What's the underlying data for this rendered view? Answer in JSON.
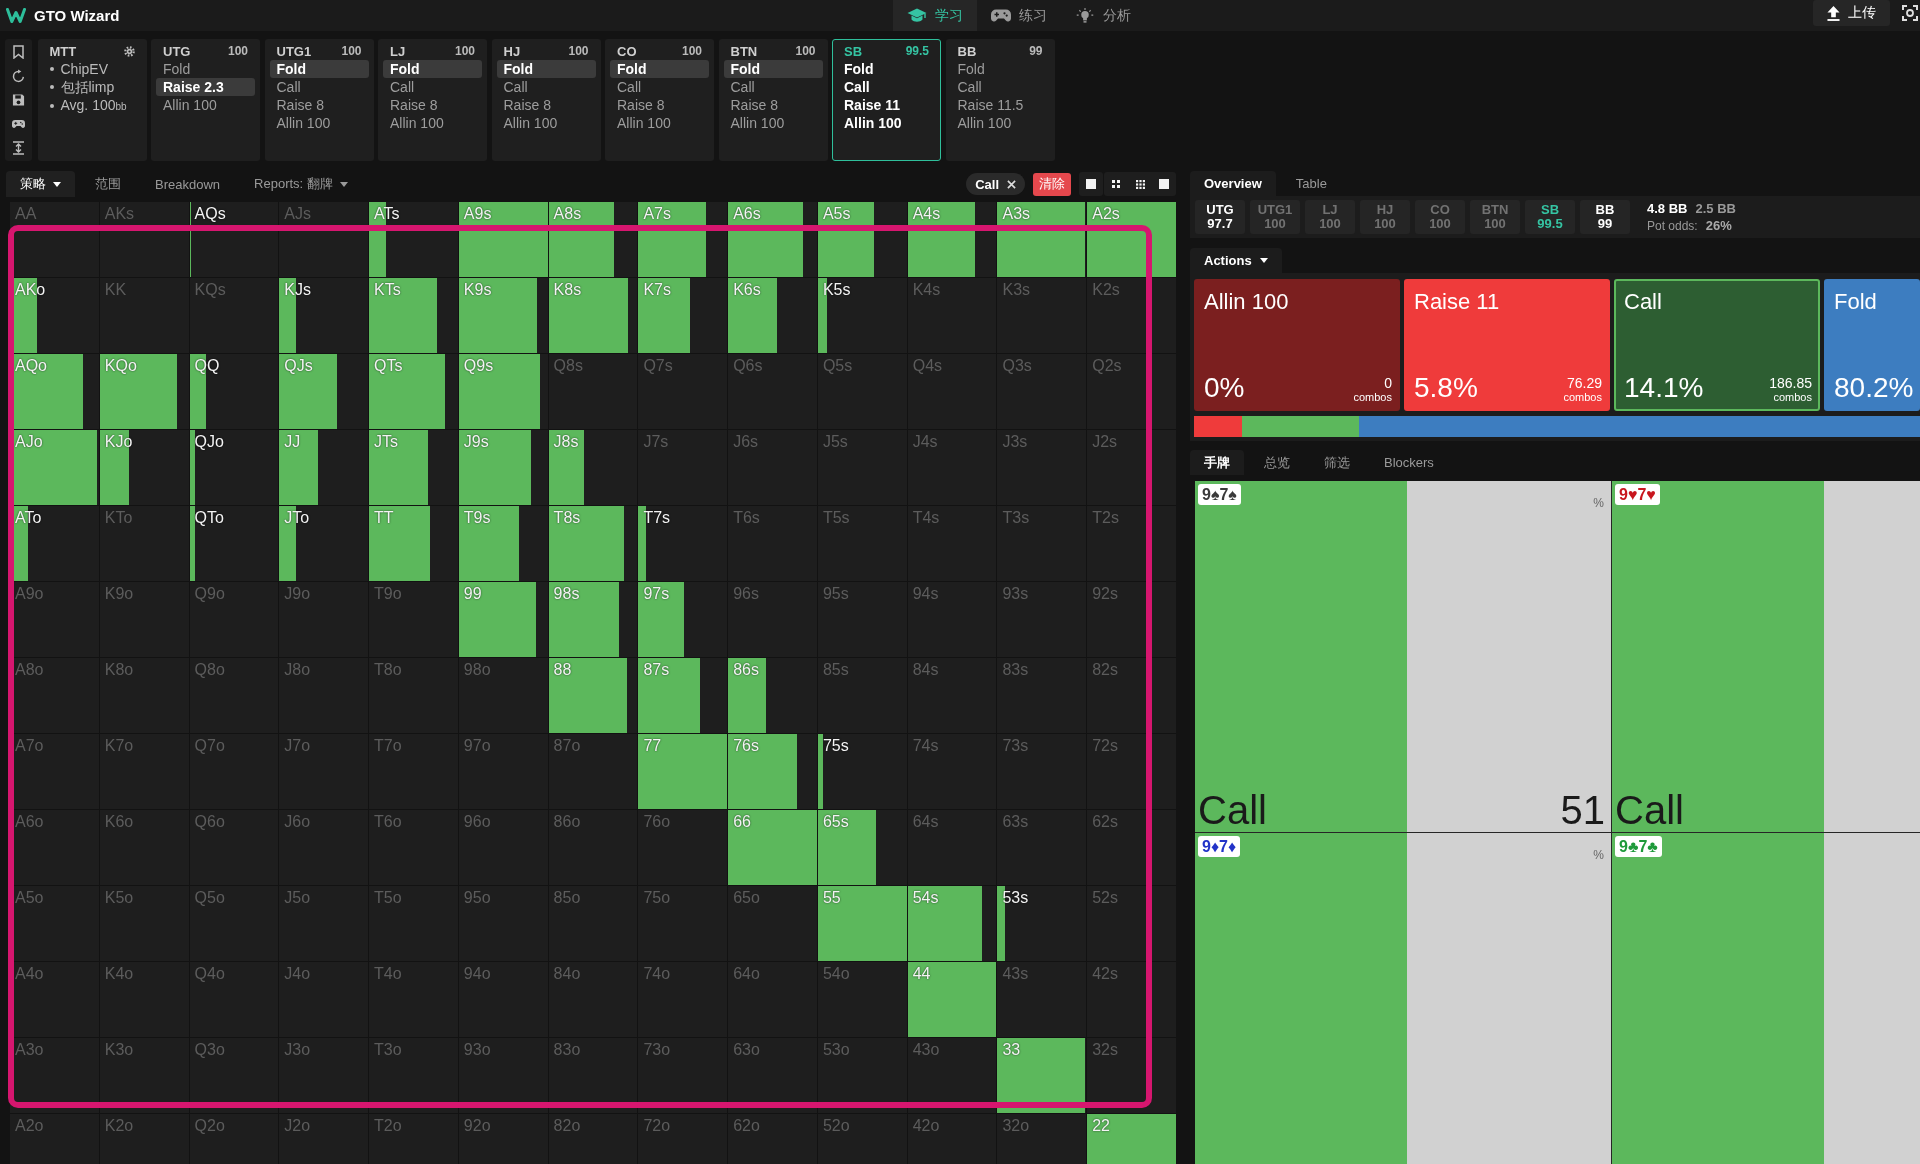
{
  "app_bar": {
    "title": "GTO Wizard",
    "nav": [
      {
        "label": "学习",
        "selected": true
      },
      {
        "label": "练习",
        "selected": false
      },
      {
        "label": "分析",
        "selected": false
      }
    ],
    "upload_button": "上传"
  },
  "settings_card": {
    "title": "MTT",
    "items": [
      "ChipEV",
      "包括limp",
      "Avg. 100$_{bb}$"
    ]
  },
  "positions": [
    {
      "name": "UTG",
      "stack": "100",
      "selected": false,
      "options": [
        {
          "label": "Fold",
          "selected": false
        },
        {
          "label": "Raise 2.3",
          "selected": true
        },
        {
          "label": "Allin 100",
          "selected": false
        }
      ]
    },
    {
      "name": "UTG1",
      "stack": "100",
      "selected": false,
      "options": [
        {
          "label": "Fold",
          "selected": true
        },
        {
          "label": "Call",
          "selected": false
        },
        {
          "label": "Raise 8",
          "selected": false
        },
        {
          "label": "Allin 100",
          "selected": false
        }
      ]
    },
    {
      "name": "LJ",
      "stack": "100",
      "selected": false,
      "options": [
        {
          "label": "Fold",
          "selected": true
        },
        {
          "label": "Call",
          "selected": false
        },
        {
          "label": "Raise 8",
          "selected": false
        },
        {
          "label": "Allin 100",
          "selected": false
        }
      ]
    },
    {
      "name": "HJ",
      "stack": "100",
      "selected": false,
      "options": [
        {
          "label": "Fold",
          "selected": true
        },
        {
          "label": "Call",
          "selected": false
        },
        {
          "label": "Raise 8",
          "selected": false
        },
        {
          "label": "Allin 100",
          "selected": false
        }
      ]
    },
    {
      "name": "CO",
      "stack": "100",
      "selected": false,
      "options": [
        {
          "label": "Fold",
          "selected": true
        },
        {
          "label": "Call",
          "selected": false
        },
        {
          "label": "Raise 8",
          "selected": false
        },
        {
          "label": "Allin 100",
          "selected": false
        }
      ]
    },
    {
      "name": "BTN",
      "stack": "100",
      "selected": false,
      "options": [
        {
          "label": "Fold",
          "selected": true
        },
        {
          "label": "Call",
          "selected": false
        },
        {
          "label": "Raise 8",
          "selected": false
        },
        {
          "label": "Allin 100",
          "selected": false
        }
      ]
    },
    {
      "name": "SB",
      "stack": "99.5",
      "selected": true,
      "options": [
        {
          "label": "Fold",
          "selected": false
        },
        {
          "label": "Call",
          "selected": false
        },
        {
          "label": "Raise 11",
          "selected": false
        },
        {
          "label": "Allin 100",
          "selected": false
        }
      ]
    },
    {
      "name": "BB",
      "stack": "99",
      "selected": false,
      "options": [
        {
          "label": "Fold",
          "selected": false
        },
        {
          "label": "Call",
          "selected": false
        },
        {
          "label": "Raise 11.5",
          "selected": false
        },
        {
          "label": "Allin 100",
          "selected": false
        }
      ]
    }
  ],
  "view_tabs": [
    {
      "label": "策略",
      "selected": true,
      "has_menu": true
    },
    {
      "label": "范围",
      "selected": false,
      "has_menu": false
    },
    {
      "label": "Breakdown",
      "selected": false,
      "has_menu": false
    },
    {
      "label": "Reports: 翻牌",
      "selected": false,
      "has_menu": true
    }
  ],
  "filter_chip": "Call",
  "clear_button": "清除",
  "range_grid": {
    "rows": [
      [
        {
          "label": "AA"
        },
        {
          "label": "AKs"
        },
        {
          "label": "AQs",
          "level": 0.02
        },
        {
          "label": "AJs"
        },
        {
          "label": "ATs",
          "level": 0.19
        },
        {
          "label": "A9s",
          "level": 1
        },
        {
          "label": "A8s",
          "level": 0.74
        },
        {
          "label": "A7s",
          "level": 0.76
        },
        {
          "label": "A6s",
          "level": 0.84
        },
        {
          "label": "A5s",
          "level": 0.63
        },
        {
          "label": "A4s",
          "level": 0.76
        },
        {
          "label": "A3s",
          "level": 0.99
        },
        {
          "label": "A2s",
          "level": 1
        }
      ],
      [
        {
          "label": "AKo",
          "level": 0.3
        },
        {
          "label": "KK"
        },
        {
          "label": "KQs"
        },
        {
          "label": "KJs",
          "level": 0.19
        },
        {
          "label": "KTs",
          "level": 0.76
        },
        {
          "label": "K9s",
          "level": 0.88
        },
        {
          "label": "K8s",
          "level": 0.89
        },
        {
          "label": "K7s",
          "level": 0.58
        },
        {
          "label": "K6s",
          "level": 0.55
        },
        {
          "label": "K5s",
          "level": 0.1
        },
        {
          "label": "K4s"
        },
        {
          "label": "K3s"
        },
        {
          "label": "K2s"
        }
      ],
      [
        {
          "label": "AQo",
          "level": 0.82
        },
        {
          "label": "KQo",
          "level": 0.87
        },
        {
          "label": "QQ",
          "level": 0.18
        },
        {
          "label": "QJs",
          "level": 0.65
        },
        {
          "label": "QTs",
          "level": 0.85
        },
        {
          "label": "Q9s",
          "level": 0.91
        },
        {
          "label": "Q8s"
        },
        {
          "label": "Q7s"
        },
        {
          "label": "Q6s"
        },
        {
          "label": "Q5s"
        },
        {
          "label": "Q4s"
        },
        {
          "label": "Q3s"
        },
        {
          "label": "Q2s"
        }
      ],
      [
        {
          "label": "AJo",
          "level": 0.98
        },
        {
          "label": "KJo",
          "level": 0.33
        },
        {
          "label": "QJo",
          "level": 0.06
        },
        {
          "label": "JJ",
          "level": 0.44
        },
        {
          "label": "JTs",
          "level": 0.66
        },
        {
          "label": "J9s",
          "level": 0.81
        },
        {
          "label": "J8s",
          "level": 0.4
        },
        {
          "label": "J7s"
        },
        {
          "label": "J6s"
        },
        {
          "label": "J5s"
        },
        {
          "label": "J4s"
        },
        {
          "label": "J3s"
        },
        {
          "label": "J2s"
        }
      ],
      [
        {
          "label": "ATo",
          "level": 0.2
        },
        {
          "label": "KTo"
        },
        {
          "label": "QTo",
          "level": 0.06
        },
        {
          "label": "JTo",
          "level": 0.19
        },
        {
          "label": "TT",
          "level": 0.69
        },
        {
          "label": "T9s",
          "level": 0.68
        },
        {
          "label": "T8s",
          "level": 0.85
        },
        {
          "label": "T7s",
          "level": 0.09
        },
        {
          "label": "T6s"
        },
        {
          "label": "T5s"
        },
        {
          "label": "T4s"
        },
        {
          "label": "T3s"
        },
        {
          "label": "T2s"
        }
      ],
      [
        {
          "label": "A9o"
        },
        {
          "label": "K9o"
        },
        {
          "label": "Q9o"
        },
        {
          "label": "J9o"
        },
        {
          "label": "T9o"
        },
        {
          "label": "99",
          "level": 0.87
        },
        {
          "label": "98s",
          "level": 0.79
        },
        {
          "label": "97s",
          "level": 0.51
        },
        {
          "label": "96s"
        },
        {
          "label": "95s"
        },
        {
          "label": "94s"
        },
        {
          "label": "93s"
        },
        {
          "label": "92s"
        }
      ],
      [
        {
          "label": "A8o"
        },
        {
          "label": "K8o"
        },
        {
          "label": "Q8o"
        },
        {
          "label": "J8o"
        },
        {
          "label": "T8o"
        },
        {
          "label": "98o"
        },
        {
          "label": "88",
          "level": 0.88
        },
        {
          "label": "87s",
          "level": 0.69
        },
        {
          "label": "86s",
          "level": 0.43
        },
        {
          "label": "85s"
        },
        {
          "label": "84s"
        },
        {
          "label": "83s"
        },
        {
          "label": "82s"
        }
      ],
      [
        {
          "label": "A7o"
        },
        {
          "label": "K7o"
        },
        {
          "label": "Q7o"
        },
        {
          "label": "J7o"
        },
        {
          "label": "T7o"
        },
        {
          "label": "97o"
        },
        {
          "label": "87o"
        },
        {
          "label": "77",
          "level": 1
        },
        {
          "label": "76s",
          "level": 0.78
        },
        {
          "label": "75s",
          "level": 0.06
        },
        {
          "label": "74s"
        },
        {
          "label": "73s"
        },
        {
          "label": "72s"
        }
      ],
      [
        {
          "label": "A6o"
        },
        {
          "label": "K6o"
        },
        {
          "label": "Q6o"
        },
        {
          "label": "J6o"
        },
        {
          "label": "T6o"
        },
        {
          "label": "96o"
        },
        {
          "label": "86o"
        },
        {
          "label": "76o"
        },
        {
          "label": "66",
          "level": 1
        },
        {
          "label": "65s",
          "level": 0.65
        },
        {
          "label": "64s"
        },
        {
          "label": "63s"
        },
        {
          "label": "62s"
        }
      ],
      [
        {
          "label": "A5o"
        },
        {
          "label": "K5o"
        },
        {
          "label": "Q5o"
        },
        {
          "label": "J5o"
        },
        {
          "label": "T5o"
        },
        {
          "label": "95o"
        },
        {
          "label": "85o"
        },
        {
          "label": "75o"
        },
        {
          "label": "65o"
        },
        {
          "label": "55",
          "level": 1
        },
        {
          "label": "54s",
          "level": 0.84
        },
        {
          "label": "53s",
          "level": 0.08
        },
        {
          "label": "52s"
        }
      ],
      [
        {
          "label": "A4o"
        },
        {
          "label": "K4o"
        },
        {
          "label": "Q4o"
        },
        {
          "label": "J4o"
        },
        {
          "label": "T4o"
        },
        {
          "label": "94o"
        },
        {
          "label": "84o"
        },
        {
          "label": "74o"
        },
        {
          "label": "64o"
        },
        {
          "label": "54o"
        },
        {
          "label": "44",
          "level": 1
        },
        {
          "label": "43s"
        },
        {
          "label": "42s"
        }
      ],
      [
        {
          "label": "A3o"
        },
        {
          "label": "K3o"
        },
        {
          "label": "Q3o"
        },
        {
          "label": "J3o"
        },
        {
          "label": "T3o"
        },
        {
          "label": "93o"
        },
        {
          "label": "83o"
        },
        {
          "label": "73o"
        },
        {
          "label": "63o"
        },
        {
          "label": "53o"
        },
        {
          "label": "43o"
        },
        {
          "label": "33",
          "level": 0.99
        },
        {
          "label": "32s"
        }
      ],
      [
        {
          "label": "A2o"
        },
        {
          "label": "K2o"
        },
        {
          "label": "Q2o"
        },
        {
          "label": "J2o"
        },
        {
          "label": "T2o"
        },
        {
          "label": "92o"
        },
        {
          "label": "82o"
        },
        {
          "label": "72o"
        },
        {
          "label": "62o"
        },
        {
          "label": "52o"
        },
        {
          "label": "42o"
        },
        {
          "label": "32o"
        },
        {
          "label": "22",
          "level": 1
        }
      ]
    ]
  },
  "annotation": {
    "kind": "rectangle"
  },
  "panel_tabs": [
    {
      "label": "Overview",
      "selected": true
    },
    {
      "label": "Table",
      "selected": false
    }
  ],
  "seats": [
    {
      "name": "UTG",
      "stack": "97.7",
      "folded": false,
      "selected": false
    },
    {
      "name": "UTG1",
      "stack": "100",
      "folded": true,
      "selected": false
    },
    {
      "name": "LJ",
      "stack": "100",
      "folded": true,
      "selected": false
    },
    {
      "name": "HJ",
      "stack": "100",
      "folded": true,
      "selected": false
    },
    {
      "name": "CO",
      "stack": "100",
      "folded": true,
      "selected": false
    },
    {
      "name": "BTN",
      "stack": "100",
      "folded": true,
      "selected": false
    },
    {
      "name": "SB",
      "stack": "99.5",
      "folded": false,
      "selected": true
    },
    {
      "name": "BB",
      "stack": "99",
      "folded": false,
      "selected": false
    }
  ],
  "pot": {
    "amount": "4.8 BB",
    "secondary": "2.5 BB",
    "odds_label": "Pot odds:",
    "odds": "26%"
  },
  "actions": {
    "menu": "Actions",
    "cards": [
      {
        "title": "Allin 100",
        "percent": "0%",
        "combos": "0",
        "combos_label": "combos",
        "color": "#7b1f1f",
        "selected": false
      },
      {
        "title": "Raise 11",
        "percent": "5.8%",
        "combos": "76.29",
        "combos_label": "combos",
        "color": "#ef3b3b",
        "selected": false
      },
      {
        "title": "Call",
        "percent": "14.1%",
        "combos": "186.85",
        "combos_label": "combos",
        "color": "#2d5e32",
        "selected": true
      },
      {
        "title": "Fold",
        "percent": "80.2%",
        "color": "#3d7dc0",
        "selected": false
      }
    ]
  },
  "strategy_bar": {
    "segments": [
      {
        "color": "#ef3b3b",
        "level": 0.066
      },
      {
        "color": "#5cb85c",
        "level": 0.161
      },
      {
        "color": "#3d7dc0",
        "level": 0.773
      }
    ]
  },
  "hand_tabs": [
    {
      "label": "手牌",
      "selected": true
    },
    {
      "label": "总览",
      "selected": false
    },
    {
      "label": "筛选",
      "selected": false
    },
    {
      "label": "Blockers",
      "selected": false
    }
  ],
  "combos": [
    {
      "hand": "9♠7♠",
      "color": "#3a3a3a",
      "level": 0.51,
      "unit": "%",
      "action": "Call",
      "value": "51"
    },
    {
      "hand": "9♥7♥",
      "color": "#c8161e",
      "level": 0.51,
      "action": "Call"
    },
    {
      "hand": "9♦7♦",
      "color": "#2233c8",
      "level": 0.51,
      "unit": "%"
    },
    {
      "hand": "9♣7♣",
      "color": "#1e9a3a",
      "level": 0.51
    }
  ]
}
